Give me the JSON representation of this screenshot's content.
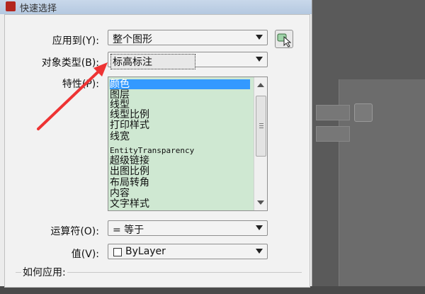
{
  "window": {
    "title": "快速选择"
  },
  "form": {
    "apply_to": {
      "label": "应用到(Y):",
      "value": "整个图形"
    },
    "object_type": {
      "label": "对象类型(B):",
      "value": "标高标注"
    },
    "properties": {
      "label": "特性(P):",
      "items": [
        "颜色",
        "图层",
        "线型",
        "线型比例",
        "打印样式",
        "线宽",
        "EntityTransparency",
        "超级链接",
        "出图比例",
        "布局转角",
        "内容",
        "文字样式"
      ],
      "selected_index": 0
    },
    "operator": {
      "label": "运算符(O):",
      "value": "= 等于"
    },
    "value": {
      "label": "值(V):",
      "value": "ByLayer"
    },
    "how_to_apply": {
      "label": "如何应用:"
    }
  },
  "colors": {
    "selection": "#3399ff",
    "listbox_bg": "#cfe8d2",
    "annotation_arrow": "#ee3333"
  }
}
